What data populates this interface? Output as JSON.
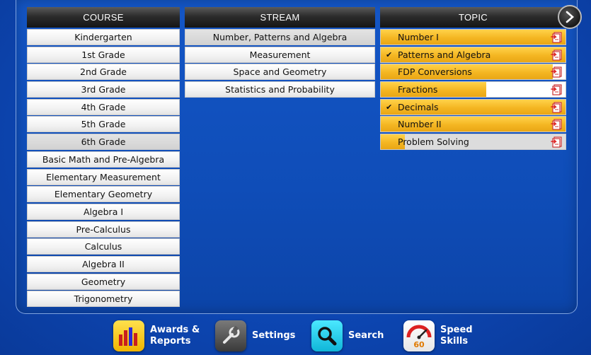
{
  "course": {
    "header": "COURSE",
    "selected_index": 6,
    "items": [
      "Kindergarten",
      "1st Grade",
      "2nd Grade",
      "3rd Grade",
      "4th Grade",
      "5th Grade",
      "6th Grade",
      "Basic Math and Pre-Algebra",
      "Elementary Measurement",
      "Elementary Geometry",
      "Algebra I",
      "Pre-Calculus",
      "Calculus",
      "Algebra II",
      "Geometry",
      "Trigonometry"
    ]
  },
  "stream": {
    "header": "STREAM",
    "selected_index": 0,
    "items": [
      "Number, Patterns and Algebra",
      "Measurement",
      "Space and Geometry",
      "Statistics and Probability"
    ]
  },
  "topic": {
    "header": "TOPIC",
    "items": [
      {
        "label": "Number I",
        "checked": false,
        "progress": 1.0
      },
      {
        "label": "Patterns and Algebra",
        "checked": true,
        "progress": 1.0
      },
      {
        "label": "FDP Conversions",
        "checked": false,
        "progress": 0.93
      },
      {
        "label": "Fractions",
        "checked": false,
        "progress": 0.57
      },
      {
        "label": "Decimals",
        "checked": true,
        "progress": 1.0
      },
      {
        "label": "Number II",
        "checked": false,
        "progress": 1.0
      },
      {
        "label": "Problem Solving",
        "checked": false,
        "progress": 0.13
      }
    ]
  },
  "toolbar": {
    "awards_label": "Awards &\nReports",
    "settings_label": "Settings",
    "search_label": "Search",
    "speed_label": "Speed\nSkills",
    "speed_number": "60"
  },
  "colors": {
    "progress_fill": "#f4b622",
    "background": "#0d47b4"
  }
}
